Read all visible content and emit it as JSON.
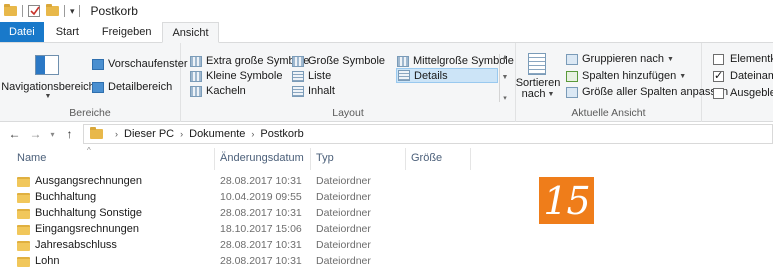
{
  "titlebar": {
    "title": "Postkorb",
    "qa_icons": [
      "folder-icon",
      "properties-check-icon",
      "new-folder-icon",
      "dropdown-icon"
    ]
  },
  "tabs": [
    {
      "label": "Datei"
    },
    {
      "label": "Start"
    },
    {
      "label": "Freigeben"
    },
    {
      "label": "Ansicht"
    }
  ],
  "ribbon": {
    "bereiche": {
      "navigationsbereich": "Navigationsbereich",
      "vorschaufenster": "Vorschaufenster",
      "detailbereich": "Detailbereich",
      "label": "Bereiche"
    },
    "layout": {
      "extra_gross": "Extra große Symbole",
      "gross": "Große Symbole",
      "mittelgross": "Mittelgroße Symbole",
      "klein": "Kleine Symbole",
      "liste": "Liste",
      "details": "Details",
      "kacheln": "Kacheln",
      "inhalt": "Inhalt",
      "label": "Layout"
    },
    "ansicht": {
      "sortieren": "Sortieren",
      "nach": "nach",
      "gruppieren": "Gruppieren nach",
      "spalten_hinzu": "Spalten hinzufügen",
      "groesse_spalten": "Größe aller Spalten anpassen",
      "label": "Aktuelle Ansicht"
    },
    "anzeigen": {
      "elementkon": "Elementkon",
      "dateiname": "Dateinamer",
      "ausgeblend": "Ausgeblend",
      "dateiname_checked": true
    }
  },
  "address": {
    "crumbs": [
      "Dieser PC",
      "Dokumente",
      "Postkorb"
    ]
  },
  "columns": {
    "name": "Name",
    "date": "Änderungsdatum",
    "type": "Typ",
    "size": "Größe"
  },
  "rows": [
    {
      "name": "Ausgangsrechnungen",
      "date": "28.08.2017 10:31",
      "type": "Dateiordner"
    },
    {
      "name": "Buchhaltung",
      "date": "10.04.2019 09:55",
      "type": "Dateiordner"
    },
    {
      "name": "Buchhaltung Sonstige",
      "date": "28.08.2017 10:31",
      "type": "Dateiordner"
    },
    {
      "name": "Eingangsrechnungen",
      "date": "18.10.2017 15:06",
      "type": "Dateiordner"
    },
    {
      "name": "Jahresabschluss",
      "date": "28.08.2017 10:31",
      "type": "Dateiordner"
    },
    {
      "name": "Lohn",
      "date": "28.08.2017 10:31",
      "type": "Dateiordner"
    }
  ],
  "badge": {
    "number": "15",
    "color": "#ef7d1a"
  },
  "colors": {
    "file_tab": "#1979ca",
    "selection": "#cce4f7",
    "folder": "#f1c75b"
  }
}
